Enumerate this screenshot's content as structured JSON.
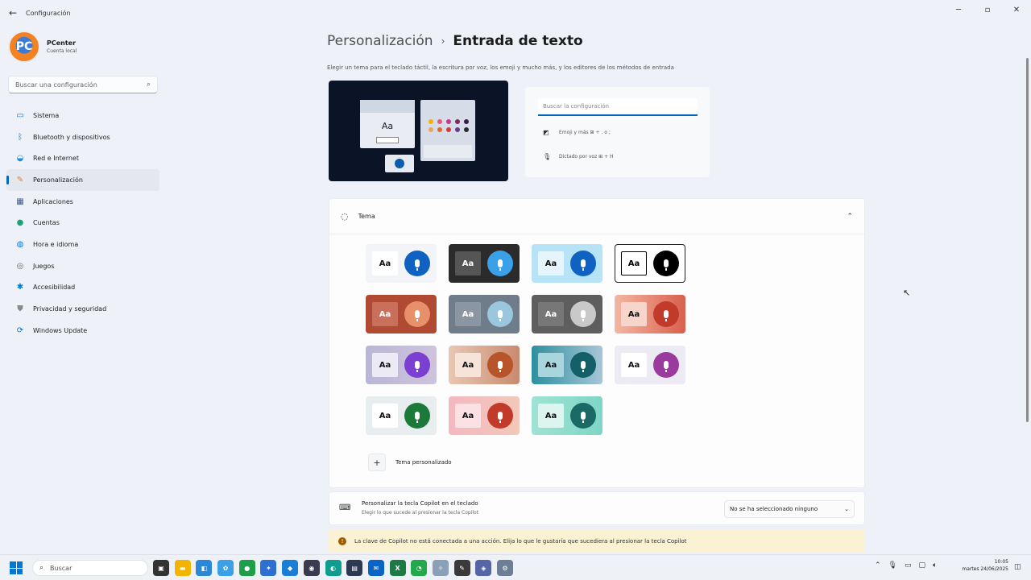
{
  "window": {
    "title": "Configuración"
  },
  "profile": {
    "name": "PCenter",
    "account": "Cuenta local",
    "initials": "PC"
  },
  "sidebar": {
    "search_placeholder": "Buscar una configuración",
    "items": [
      {
        "label": "Sistema",
        "icon": "monitor-icon",
        "color": "#0078d4",
        "active": false
      },
      {
        "label": "Bluetooth y dispositivos",
        "icon": "bluetooth-icon",
        "color": "#0078d4",
        "active": false
      },
      {
        "label": "Red e Internet",
        "icon": "wifi-icon",
        "color": "#1e90d8",
        "active": false
      },
      {
        "label": "Personalización",
        "icon": "brush-icon",
        "color": "#e0803a",
        "active": true
      },
      {
        "label": "Aplicaciones",
        "icon": "apps-icon",
        "color": "#3c5a8a",
        "active": false
      },
      {
        "label": "Cuentas",
        "icon": "person-icon",
        "color": "#1aa37a",
        "active": false
      },
      {
        "label": "Hora e idioma",
        "icon": "globe-clock-icon",
        "color": "#0078d4",
        "active": false
      },
      {
        "label": "Juegos",
        "icon": "gamepad-icon",
        "color": "#666666",
        "active": false
      },
      {
        "label": "Accesibilidad",
        "icon": "accessibility-icon",
        "color": "#0078d4",
        "active": false
      },
      {
        "label": "Privacidad y seguridad",
        "icon": "shield-icon",
        "color": "#888888",
        "active": false
      },
      {
        "label": "Windows Update",
        "icon": "update-icon",
        "color": "#0078d4",
        "active": false
      }
    ]
  },
  "header": {
    "parent": "Personalización",
    "current": "Entrada de texto"
  },
  "description": "Elegir un tema para el teclado táctil, la escritura por voz, los emoji y mucho más, y los editores de los métodos de entrada",
  "preview_panel": {
    "aa": "Aa",
    "search_placeholder": "Buscar la configuración",
    "emoji_row": "Emoji y más ⊞ + . o ;",
    "dictation_row": "Dictado por voz ⊞ + H"
  },
  "theme_section": {
    "title": "Tema",
    "custom_label": "Tema personalizado",
    "swatches": [
      {
        "name": "light-blue",
        "bg": "#f2f4f7",
        "aa_bg": "#ffffff",
        "aa_fg": "#111111",
        "mic": "#0f62c2",
        "selected": false
      },
      {
        "name": "dark",
        "bg": "#2b2b2b",
        "aa_bg": "#555555",
        "aa_fg": "#ffffff",
        "mic": "#3aa0e8",
        "selected": false
      },
      {
        "name": "sky",
        "bg": "#b6e3f5",
        "aa_bg": "#e6f5fb",
        "aa_fg": "#111111",
        "mic": "#0f62c2",
        "selected": false
      },
      {
        "name": "high-contrast",
        "bg": "#ffffff",
        "aa_bg": "#ffffff",
        "aa_fg": "#000000",
        "mic": "#000000",
        "selected": true
      },
      {
        "name": "brick",
        "bg": "#b04a33",
        "aa_bg": "#c9705c",
        "aa_fg": "#ffffff",
        "mic": "#e8906a",
        "selected": false
      },
      {
        "name": "slate",
        "bg": "#6f7c89",
        "aa_bg": "#8b96a2",
        "aa_fg": "#ffffff",
        "mic": "#9ac7de",
        "selected": false
      },
      {
        "name": "graphite",
        "bg": "#5e5e5e",
        "aa_bg": "#777777",
        "aa_fg": "#ffffff",
        "mic": "#c9c9c9",
        "selected": false
      },
      {
        "name": "sunset",
        "bg": "linear-gradient(90deg,#f3b7a3,#d9604e)",
        "aa_bg": "#f8d5ca",
        "aa_fg": "#111111",
        "mic": "#c23a2a",
        "selected": false
      },
      {
        "name": "lavender",
        "bg": "linear-gradient(90deg,#b9b6d6,#cfc3dd)",
        "aa_bg": "#ecebf5",
        "aa_fg": "#111111",
        "mic": "#7b3fd2",
        "selected": false
      },
      {
        "name": "sand",
        "bg": "linear-gradient(90deg,#e9c7b3,#c98a6e)",
        "aa_bg": "#f6e4da",
        "aa_fg": "#111111",
        "mic": "#b8542a",
        "selected": false
      },
      {
        "name": "teal-glass",
        "bg": "linear-gradient(90deg,#2d8f9e,#a7c6d8)",
        "aa_bg": "#a9d5dc",
        "aa_fg": "#111111",
        "mic": "#155f68",
        "selected": false
      },
      {
        "name": "orchid",
        "bg": "#eceaf3",
        "aa_bg": "#ffffff",
        "aa_fg": "#111111",
        "mic": "#9a3a9c",
        "selected": false
      },
      {
        "name": "mint",
        "bg": "#e8eef0",
        "aa_bg": "#ffffff",
        "aa_fg": "#111111",
        "mic": "#1b7a3a",
        "selected": false
      },
      {
        "name": "rose",
        "bg": "linear-gradient(90deg,#f4b8c1,#f2c8b8)",
        "aa_bg": "#fbe1e4",
        "aa_fg": "#111111",
        "mic": "#c23a2a",
        "selected": false
      },
      {
        "name": "aqua",
        "bg": "linear-gradient(90deg,#9fe3d4,#7fd6c6)",
        "aa_bg": "#dcf5ef",
        "aa_fg": "#111111",
        "mic": "#1c6a66",
        "selected": false
      }
    ]
  },
  "copilot": {
    "title": "Personalizar la tecla Copilot en el teclado",
    "subtitle": "Elegir lo que sucede al presionar la tecla Copilot",
    "select_value": "No se ha seleccionado ninguno"
  },
  "warning": "La clave de Copilot no está conectada a una acción. Elija lo que le gustaría que sucediera al presionar la tecla Copilot",
  "taskbar": {
    "search_placeholder": "Buscar",
    "apps": [
      {
        "name": "task-view",
        "color": "#333333",
        "glyph": "▣"
      },
      {
        "name": "file-explorer",
        "color": "#f2b400",
        "glyph": "▬"
      },
      {
        "name": "store",
        "color": "#2b88d8",
        "glyph": "◧"
      },
      {
        "name": "photos",
        "color": "#3aa0e8",
        "glyph": "✿"
      },
      {
        "name": "chrome",
        "color": "#1e9e4a",
        "glyph": "●"
      },
      {
        "name": "app-blue",
        "color": "#2e6fd1",
        "glyph": "✦"
      },
      {
        "name": "vscode",
        "color": "#1a7fd4",
        "glyph": "◆"
      },
      {
        "name": "obs",
        "color": "#3b3b4f",
        "glyph": "◉"
      },
      {
        "name": "edge",
        "color": "#0f9d8f",
        "glyph": "◐"
      },
      {
        "name": "app-dark",
        "color": "#2b3a52",
        "glyph": "▤"
      },
      {
        "name": "outlook",
        "color": "#0a64c8",
        "glyph": "✉"
      },
      {
        "name": "excel",
        "color": "#1d7a45",
        "glyph": "X"
      },
      {
        "name": "whatsapp",
        "color": "#25a84b",
        "glyph": "◔"
      },
      {
        "name": "app-light",
        "color": "#8aa0b8",
        "glyph": "✧"
      },
      {
        "name": "editor",
        "color": "#3a3a3a",
        "glyph": "✎"
      },
      {
        "name": "security",
        "color": "#5565a8",
        "glyph": "◈"
      },
      {
        "name": "settings",
        "color": "#6e7f95",
        "glyph": "⚙"
      }
    ],
    "time": "10:05",
    "date": "martes 24/06/2025"
  }
}
